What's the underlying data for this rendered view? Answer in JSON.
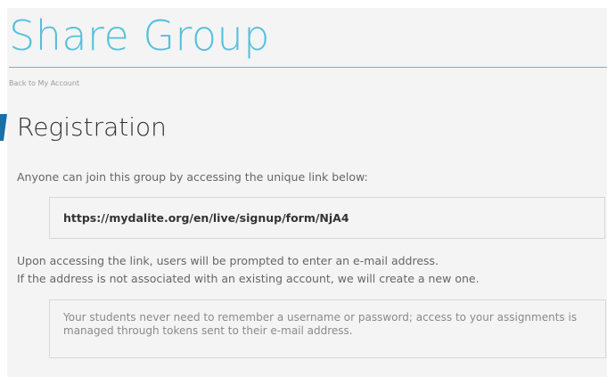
{
  "page": {
    "title": "Share Group",
    "back_link": "Back to My Account"
  },
  "registration": {
    "heading": "Registration",
    "intro": "Anyone can join this group by accessing the unique link below:",
    "signup_link": "https://mydalite.org/en/live/signup/form/NjA4",
    "info_line_1": "Upon accessing the link, users will be prompted to enter an e-mail address.",
    "info_line_2": "If the address is not associated with an existing account, we will create a new one.",
    "note": "Your students never need to remember a username or password; access to your assignments is managed through tokens sent to their e-mail address."
  },
  "colors": {
    "accent": "#54c0db",
    "accent_dark": "#1a6fa8",
    "panel_bg": "#f4f4f4",
    "text_dark": "#333333",
    "text_muted": "#666666"
  }
}
